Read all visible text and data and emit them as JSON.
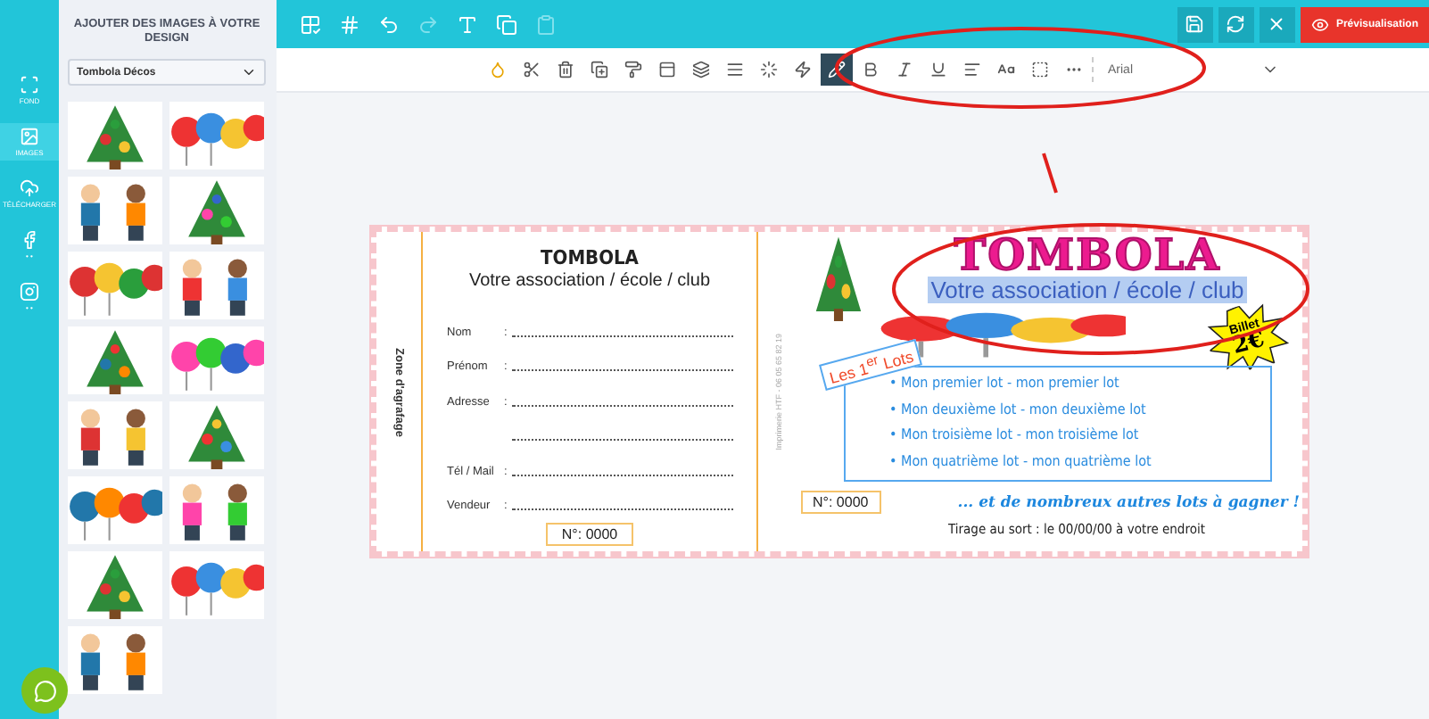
{
  "rail": [
    {
      "kind": "fond",
      "label": "FOND",
      "selected": false
    },
    {
      "kind": "images",
      "label": "IMAGES",
      "selected": true
    },
    {
      "kind": "upload",
      "label": "TÉLÉCHARGER",
      "selected": false
    },
    {
      "kind": "facebook",
      "label": "• •",
      "selected": false
    },
    {
      "kind": "instagram",
      "label": "• •",
      "selected": false
    }
  ],
  "sidebar": {
    "title": "AJOUTER DES IMAGES À VOTRE DESIGN",
    "category": "Tombola Décos"
  },
  "top_tools": [
    {
      "kind": "frame",
      "disabled": false
    },
    {
      "kind": "grid",
      "disabled": false
    },
    {
      "kind": "undo",
      "disabled": false
    },
    {
      "kind": "redo",
      "disabled": true
    },
    {
      "kind": "text",
      "disabled": false
    },
    {
      "kind": "duplicate",
      "disabled": false
    },
    {
      "kind": "paste",
      "disabled": true
    }
  ],
  "actions": [
    {
      "kind": "save"
    },
    {
      "kind": "refresh"
    },
    {
      "kind": "close"
    }
  ],
  "preview_button": "Prévisualisation",
  "format_tools": [
    {
      "kind": "color",
      "selected": false
    },
    {
      "kind": "cut",
      "selected": false
    },
    {
      "kind": "delete",
      "selected": false
    },
    {
      "kind": "copy",
      "selected": false
    },
    {
      "kind": "brush",
      "selected": false
    },
    {
      "kind": "align",
      "selected": false
    },
    {
      "kind": "layers",
      "selected": false
    },
    {
      "kind": "lines",
      "selected": false
    },
    {
      "kind": "effect",
      "selected": false
    },
    {
      "kind": "zap",
      "selected": false
    },
    {
      "kind": "pen",
      "selected": true
    },
    {
      "kind": "bold",
      "selected": false
    },
    {
      "kind": "italic",
      "selected": false
    },
    {
      "kind": "underline",
      "selected": false
    },
    {
      "kind": "left",
      "selected": false
    },
    {
      "kind": "size",
      "selected": false
    },
    {
      "kind": "box",
      "selected": false
    },
    {
      "kind": "more",
      "selected": false
    }
  ],
  "font": "Arial",
  "ticket": {
    "stub": {
      "binding": "Zone d'agrafage",
      "title": "TOMBOLA",
      "subtitle": "Votre association / école / club",
      "fields": [
        {
          "kind": "labeled",
          "label": "Nom",
          "colon": ":"
        },
        {
          "kind": "labeled",
          "label": "Prénom",
          "colon": ":"
        },
        {
          "kind": "labeled",
          "label": "Adresse",
          "colon": ":"
        },
        {
          "kind": "continuation"
        },
        {
          "kind": "labeled",
          "label": "Tél / Mail",
          "colon": ":"
        },
        {
          "kind": "labeled",
          "label": "Vendeur",
          "colon": ":"
        }
      ],
      "number": "N°:  0000"
    },
    "main": {
      "printer": "Imprimerie HTF - 06 05 65 82 19",
      "title": "TOMBOLA",
      "subtitle": "Votre association / école / club",
      "subtitle_selected": true,
      "price_label": "Billet",
      "price": "2€",
      "lots_label": "Les 1$^{er}$ Lots",
      "lots": [
        "• Mon premier lot - mon premier lot",
        "• Mon deuxième lot - mon deuxième lot",
        "• Mon troisième lot - mon troisième lot",
        "• Mon quatrième lot - mon quatrième lot"
      ],
      "number": "N°:  0000",
      "more": "... et de nombreux autres lots à gagner !",
      "draw": "Tirage au sort :  le 00/00/00 à votre endroit"
    }
  }
}
